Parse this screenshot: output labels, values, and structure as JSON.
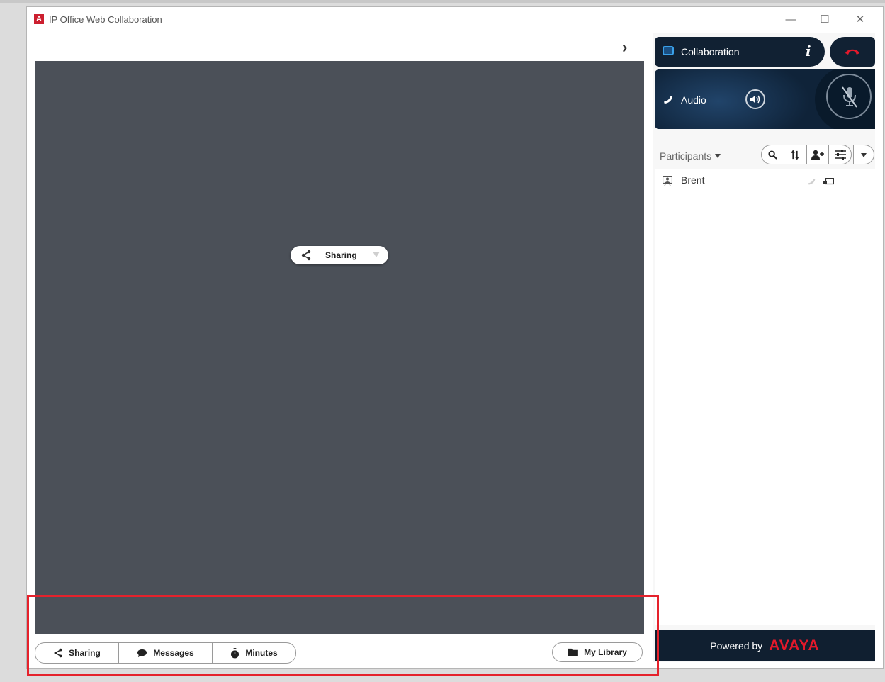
{
  "window": {
    "logo_letter": "A",
    "title": "IP Office Web Collaboration",
    "controls": {
      "minimize": "—",
      "maximize": "☐",
      "close": "✕"
    }
  },
  "collapse_arrow": "›",
  "stage": {
    "sharing_menu": {
      "label": "Sharing",
      "icon": "share-icon"
    }
  },
  "bottom_toolbar": {
    "tabs": [
      {
        "label": "Sharing",
        "icon": "share-icon"
      },
      {
        "label": "Messages",
        "icon": "chat-bubble-icon"
      },
      {
        "label": "Minutes",
        "icon": "stopwatch-icon"
      }
    ],
    "library": {
      "label": "My Library",
      "icon": "folder-icon"
    }
  },
  "right_panel": {
    "collaboration": {
      "label": "Collaboration",
      "info_glyph": "i"
    },
    "audio": {
      "label": "Audio"
    },
    "participants": {
      "label": "Participants",
      "tools": [
        "search-icon",
        "sort-icon",
        "add-participant-icon",
        "settings-sliders-icon"
      ],
      "list": [
        {
          "name": "Brent"
        }
      ]
    },
    "footer": {
      "powered_by": "Powered by",
      "brand": "AVAYA"
    }
  },
  "colors": {
    "stage_bg": "#4b5058",
    "panel_dark": "#112133",
    "hangup_red": "#e3192b",
    "brand_red": "#e3192b",
    "highlight_box": "#e5222c",
    "collab_icon_blue": "#3aa0e8"
  }
}
